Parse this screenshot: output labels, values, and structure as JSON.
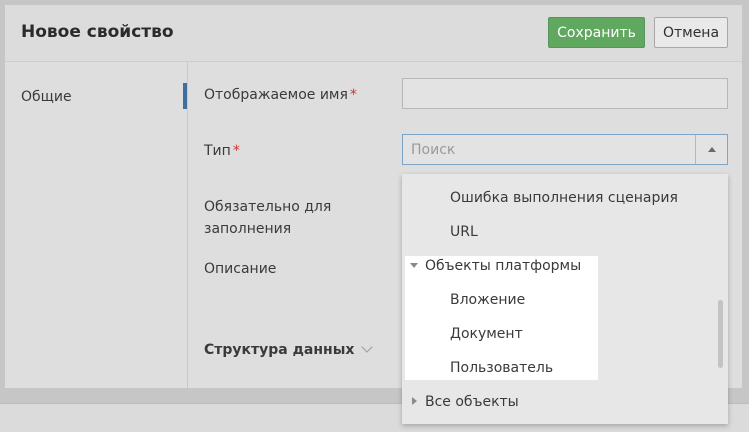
{
  "dialog": {
    "title": "Новое свойство",
    "save_label": "Сохранить",
    "cancel_label": "Отмена",
    "colors": {
      "save_bg": "#60a760",
      "accent": "#3f6f9c",
      "required": "#cc3333"
    }
  },
  "sidebar": {
    "items": [
      {
        "label": "Общие",
        "active": true
      }
    ]
  },
  "form": {
    "display_name_label": "Отображаемое имя",
    "display_name_value": "",
    "required_mark": "*",
    "type_label": "Тип",
    "type_placeholder": "Поиск",
    "mandatory_label_line1": "Обязательно для",
    "mandatory_label_line2": "заполнения",
    "description_label": "Описание",
    "data_structure_label": "Структура данных"
  },
  "dropdown": {
    "items": [
      {
        "label": "Ошибка выполнения сценария",
        "level": 1
      },
      {
        "label": "URL",
        "level": 1
      },
      {
        "label": "Объекты платформы",
        "level": 0,
        "expanded": true
      },
      {
        "label": "Вложение",
        "level": 1
      },
      {
        "label": "Документ",
        "level": 1
      },
      {
        "label": "Пользователь",
        "level": 1
      },
      {
        "label": "Все объекты",
        "level": 0,
        "expanded": false
      }
    ]
  }
}
